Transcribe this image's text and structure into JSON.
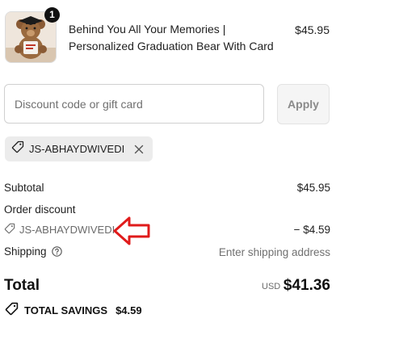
{
  "product": {
    "quantity_badge": "1",
    "title": "Behind You All Your Memories | Personalized Graduation Bear With Card",
    "price": "$45.95",
    "image_icon": "graduation-teddy-bear-image"
  },
  "discount": {
    "placeholder": "Discount code or gift card",
    "value": "",
    "apply_label": "Apply"
  },
  "applied_code": {
    "code": "JS-ABHAYDWIVEDI",
    "tag_icon": "tag-icon",
    "remove_icon": "close-icon"
  },
  "summary": {
    "subtotal_label": "Subtotal",
    "subtotal_value": "$45.95",
    "order_discount_label": "Order discount",
    "discount_code": "JS-ABHAYDWIVEDI",
    "discount_amount": "− $4.59",
    "shipping_label": "Shipping",
    "shipping_value": "Enter shipping address"
  },
  "total": {
    "label": "Total",
    "currency": "USD",
    "value": "$41.36"
  },
  "savings": {
    "label": "TOTAL SAVINGS",
    "amount": "$4.59"
  },
  "annotation": {
    "arrow_color": "#e01b1b",
    "arrow_direction": "left"
  },
  "colors": {
    "text": "#1f1f1f",
    "muted": "#707070",
    "chip_bg": "#ececec",
    "badge_bg": "#111111"
  }
}
